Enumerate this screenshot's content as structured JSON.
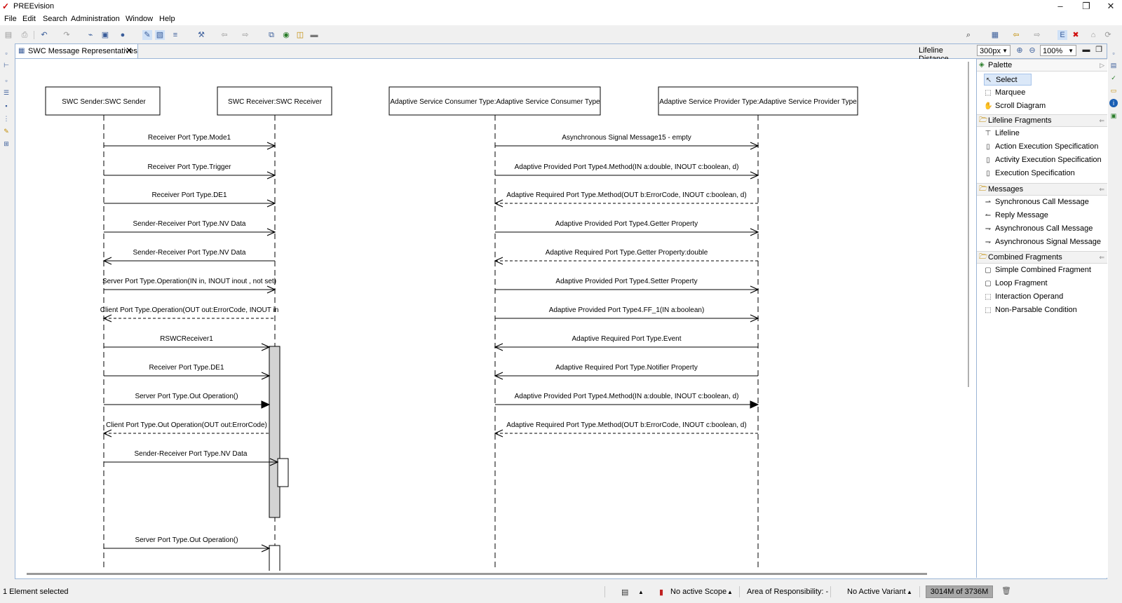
{
  "window": {
    "title": "PREEvision",
    "buttons": {
      "minimize": "–",
      "maximize": "❐",
      "close": "✕"
    }
  },
  "menu": [
    "File",
    "Edit",
    "Search",
    "Administration",
    "Window",
    "Help"
  ],
  "editor": {
    "tab_label": "SWC Message Representatives",
    "lifeline_distance_label": "Lifeline Distance",
    "lifeline_distance_value": "300px",
    "zoom_value": "100%"
  },
  "diagram": {
    "lifelines": [
      {
        "label": "SWC Sender:SWC Sender"
      },
      {
        "label": "SWC Receiver:SWC Receiver"
      },
      {
        "label": "Adaptive Service Consumer Type:Adaptive Service Consumer Type"
      },
      {
        "label": "Adaptive Service Provider Type:Adaptive Service Provider Type"
      }
    ],
    "messages_left": [
      {
        "label": "Receiver Port Type.Mode1",
        "direction": "right",
        "style": "open"
      },
      {
        "label": "Receiver Port Type.Trigger",
        "direction": "right",
        "style": "open"
      },
      {
        "label": "Receiver Port Type.DE1",
        "direction": "right",
        "style": "open"
      },
      {
        "label": "Sender-Receiver Port Type.NV Data",
        "direction": "right",
        "style": "open"
      },
      {
        "label": "Sender-Receiver Port Type.NV Data",
        "direction": "left",
        "style": "open"
      },
      {
        "label": "Server Port Type.Operation(IN in, INOUT inout , not set)",
        "direction": "right",
        "style": "open"
      },
      {
        "label": "Client Port Type.Operation(OUT out:ErrorCode, INOUT in",
        "direction": "left",
        "style": "dashed"
      },
      {
        "label": "RSWCReceiver1",
        "direction": "right",
        "style": "open"
      },
      {
        "label": "Receiver Port Type.DE1",
        "direction": "right",
        "style": "open"
      },
      {
        "label": "Server Port Type.Out Operation()",
        "direction": "right",
        "style": "filled"
      },
      {
        "label": "Client Port Type.Out Operation(OUT out:ErrorCode)",
        "direction": "left",
        "style": "dashed"
      },
      {
        "label": "Sender-Receiver Port Type.NV Data",
        "direction": "right",
        "style": "open"
      },
      {
        "label": "Server Port Type.Out Operation()",
        "direction": "right",
        "style": "open"
      }
    ],
    "messages_right": [
      {
        "label": "Asynchronous Signal Message15 - empty",
        "direction": "right",
        "style": "open"
      },
      {
        "label": "Adaptive Provided Port Type4.Method(IN a:double, INOUT c:boolean, d)",
        "direction": "right",
        "style": "open"
      },
      {
        "label": "Adaptive Required Port Type.Method(OUT b:ErrorCode, INOUT c:boolean, d)",
        "direction": "left",
        "style": "dashed"
      },
      {
        "label": "Adaptive Provided Port Type4.Getter Property",
        "direction": "right",
        "style": "open"
      },
      {
        "label": "Adaptive Required Port Type.Getter Property:double",
        "direction": "left",
        "style": "dashed"
      },
      {
        "label": "Adaptive Provided Port Type4.Setter Property",
        "direction": "right",
        "style": "open"
      },
      {
        "label": "Adaptive Provided Port Type4.FF_1(IN a:boolean)",
        "direction": "right",
        "style": "open"
      },
      {
        "label": "Adaptive Required Port Type.Event",
        "direction": "left",
        "style": "open"
      },
      {
        "label": "Adaptive Required Port Type.Notifier Property",
        "direction": "left",
        "style": "open"
      },
      {
        "label": "Adaptive Provided Port Type4.Method(IN a:double, INOUT c:boolean, d)",
        "direction": "right",
        "style": "filled"
      },
      {
        "label": "Adaptive Required Port Type.Method(OUT b:ErrorCode, INOUT c:boolean, d)",
        "direction": "left",
        "style": "dashed"
      }
    ]
  },
  "palette": {
    "title": "Palette",
    "tools": [
      {
        "label": "Select",
        "icon": "arrow-cursor-icon",
        "selected": true
      },
      {
        "label": "Marquee",
        "icon": "marquee-icon"
      },
      {
        "label": "Scroll Diagram",
        "icon": "hand-icon"
      }
    ],
    "sections": [
      {
        "title": "Lifeline Fragments",
        "items": [
          "Lifeline",
          "Action Execution Specification",
          "Activity Execution Specification",
          "Execution Specification"
        ]
      },
      {
        "title": "Messages",
        "items": [
          "Synchronous Call Message",
          "Reply Message",
          "Asynchronous Call Message",
          "Asynchronous Signal Message"
        ]
      },
      {
        "title": "Combined Fragments",
        "items": [
          "Simple Combined Fragment",
          "Loop Fragment",
          "Interaction Operand",
          "Non-Parsable Condition"
        ]
      }
    ]
  },
  "status": {
    "selection": "1 Element selected",
    "scope": "No active Scope",
    "responsibility": "Area of Responsibility: -",
    "variant": "No Active Variant",
    "memory": "3014M of 3736M"
  }
}
